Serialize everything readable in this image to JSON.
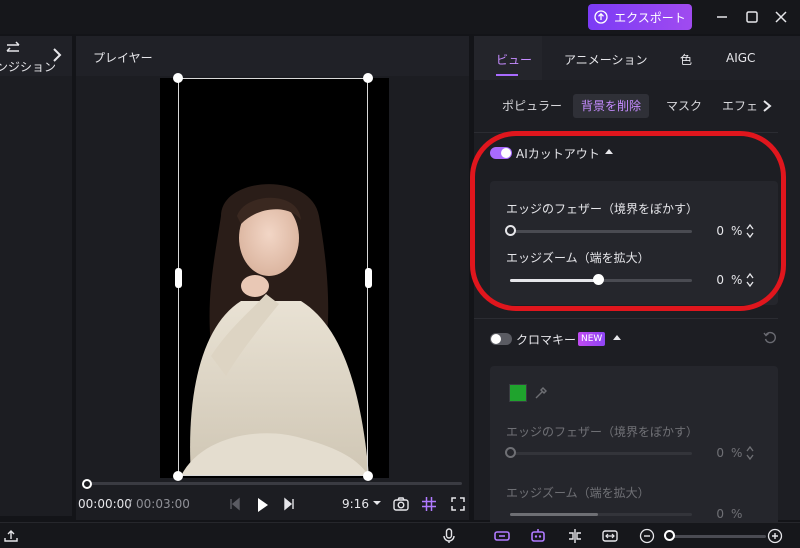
{
  "topbar": {
    "export_label": "エクスポート",
    "icons": [
      "upload-icon",
      "minimize-icon",
      "maximize-icon",
      "close-icon"
    ]
  },
  "left_panel": {
    "transition_label": "ンジション",
    "icons": [
      "swap-arrows-icon",
      "chevron-right-icon"
    ]
  },
  "player": {
    "title": "プレイヤー",
    "current_time": "00:00:00",
    "separator": "/",
    "total_time": "00:03:00",
    "ratio": "9:16",
    "progress": 0.0
  },
  "right_panel": {
    "tabs": [
      {
        "label": "ビュー",
        "active": true
      },
      {
        "label": "アニメーション",
        "active": false
      },
      {
        "label": "色",
        "active": false
      },
      {
        "label": "AIGC",
        "active": false
      }
    ],
    "subtabs": [
      {
        "label": "ポピュラー",
        "active": false
      },
      {
        "label": "背景を削除",
        "active": true
      },
      {
        "label": "マスク",
        "active": false
      },
      {
        "label": "エフェ",
        "active": false
      }
    ],
    "ai_cutout": {
      "title": "AIカットアウト",
      "enabled": true,
      "feather_label": "エッジのフェザー（境界をぼかす）",
      "feather_value": "0",
      "feather_level": 0,
      "zoom_label": "エッジズーム（端を拡大）",
      "zoom_value": "0",
      "zoom_level": 0.5,
      "unit": "%"
    },
    "chroma_key": {
      "title": "クロマキー",
      "badge": "NEW",
      "enabled": false,
      "color": "#1fa32d",
      "feather_label": "エッジのフェザー（境界をぼかす）",
      "feather_value": "0",
      "feather_level": 0,
      "zoom_label": "エッジズーム（端を拡大）",
      "zoom_value": "0",
      "zoom_level": 0.5,
      "unit": "%"
    }
  },
  "colors": {
    "accent": "#a96bff",
    "export_gradient_start": "#7b3bf5",
    "highlight_ring": "#e0161d"
  }
}
